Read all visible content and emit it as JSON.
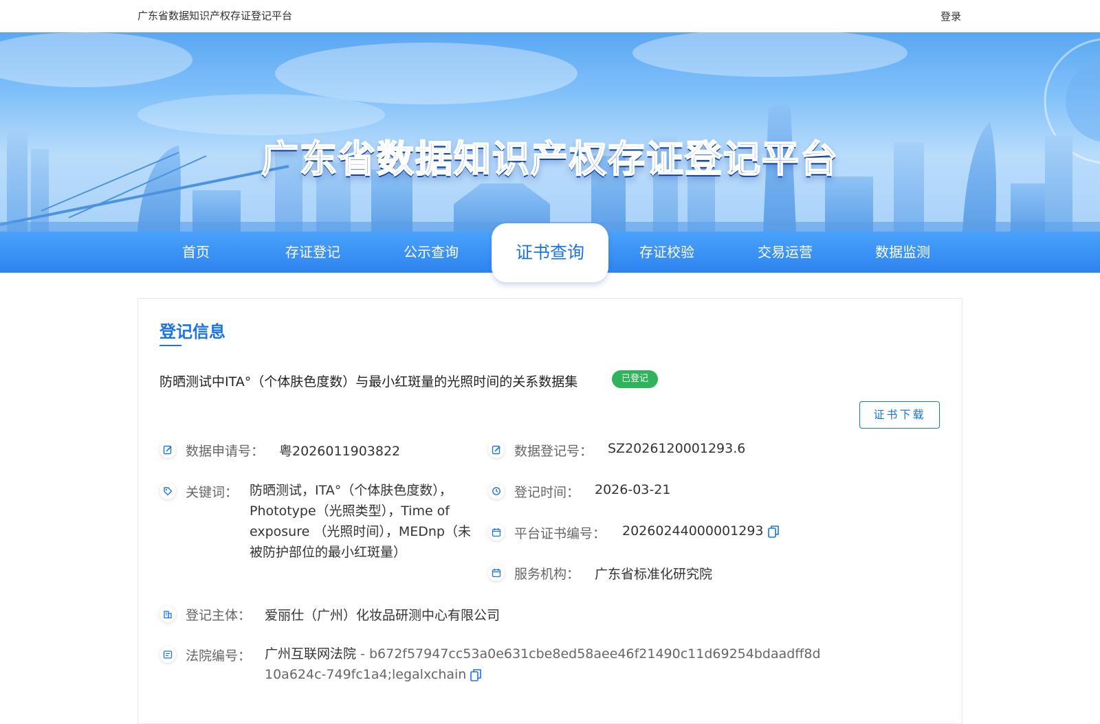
{
  "header": {
    "site_name": "广东省数据知识产权存证登记平台",
    "login_label": "登录"
  },
  "banner": {
    "title": "广东省数据知识产权存证登记平台"
  },
  "nav": {
    "active_index": 3,
    "tabs": [
      {
        "label": "首页"
      },
      {
        "label": "存证登记"
      },
      {
        "label": "公示查询"
      },
      {
        "label": "证书查询"
      },
      {
        "label": "存证校验"
      },
      {
        "label": "交易运营"
      },
      {
        "label": "数据监测"
      }
    ]
  },
  "section": {
    "title": "登记信息"
  },
  "record": {
    "title": "防晒测试中ITA°（个体肤色度数）与最小红斑量的光照时间的关系数据集",
    "status": "已登记",
    "download_label": "证书下载"
  },
  "fields": {
    "application_no": {
      "label": "数据申请号：",
      "value": "粤2026011903822",
      "icon": "edit-icon"
    },
    "registration_no": {
      "label": "数据登记号：",
      "value": "SZ2026120001293.6",
      "icon": "edit-icon"
    },
    "keywords": {
      "label": "关键词：",
      "value": "防晒测试，ITA°（个体肤色度数），Phototype（光照类型），Time of exposure （光照时间），MEDnp（未被防护部位的最小红斑量）",
      "icon": "tag-icon"
    },
    "registration_time": {
      "label": "登记时间：",
      "value": "2026-03-21",
      "icon": "clock-icon"
    },
    "certificate_no": {
      "label": "平台证书编号：",
      "value": "20260244000001293",
      "icon": "calendar-icon"
    },
    "service_org": {
      "label": "服务机构：",
      "value": "广东省标准化研究院",
      "icon": "calendar-icon"
    },
    "registrant": {
      "label": "登记主体：",
      "value": "爱丽仕（广州）化妆品研测中心有限公司",
      "icon": "building-icon"
    },
    "court_no": {
      "label": "法院编号：",
      "court": "广州互联网法院",
      "hash": " - b672f57947cc53a0e631cbe8ed58aee46f21490c11d69254bdaadff8d10a624c-749fc1a4;legalxchain",
      "icon": "certificate-icon"
    }
  },
  "colors": {
    "primary": "#1a73e8",
    "success": "#2fb35b",
    "nav": "#2e84f0"
  }
}
